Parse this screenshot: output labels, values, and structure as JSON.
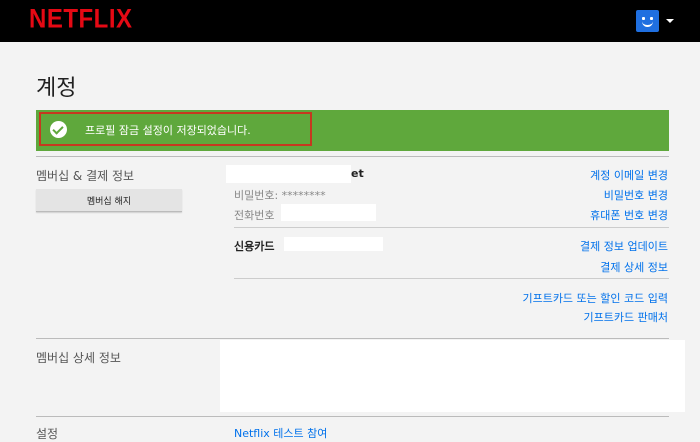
{
  "header": {
    "logo": "NETFLIX",
    "colors": {
      "bar": "#000000",
      "logo": "#e50914",
      "avatar": "#1f6fe0"
    }
  },
  "page": {
    "title": "계정"
  },
  "banner": {
    "message": "프로필 잠금 설정이 저장되었습니다.",
    "icon": "check-circle-icon",
    "color": "#5fa83c"
  },
  "membership": {
    "section_label": "멤버십 & 결제 정보",
    "cancel_button": "멤버십 해지",
    "email_suffix": "et",
    "password_label": "비밀번호: ********",
    "phone_label": "전화번호",
    "card_label": "신용카드",
    "links": {
      "change_email": "계정 이메일 변경",
      "change_password": "비밀번호 변경",
      "change_phone": "휴대폰 번호 변경",
      "update_payment": "결제 정보 업데이트",
      "payment_details": "결제 상세 정보",
      "redeem_gift": "기프트카드 또는 할인 코드 입력",
      "gift_retailers": "기프트카드 판매처"
    }
  },
  "plan": {
    "section_label": "멤버십 상세 정보"
  },
  "settings": {
    "section_label": "설정",
    "first_link": "Netflix 테스트 참여"
  }
}
